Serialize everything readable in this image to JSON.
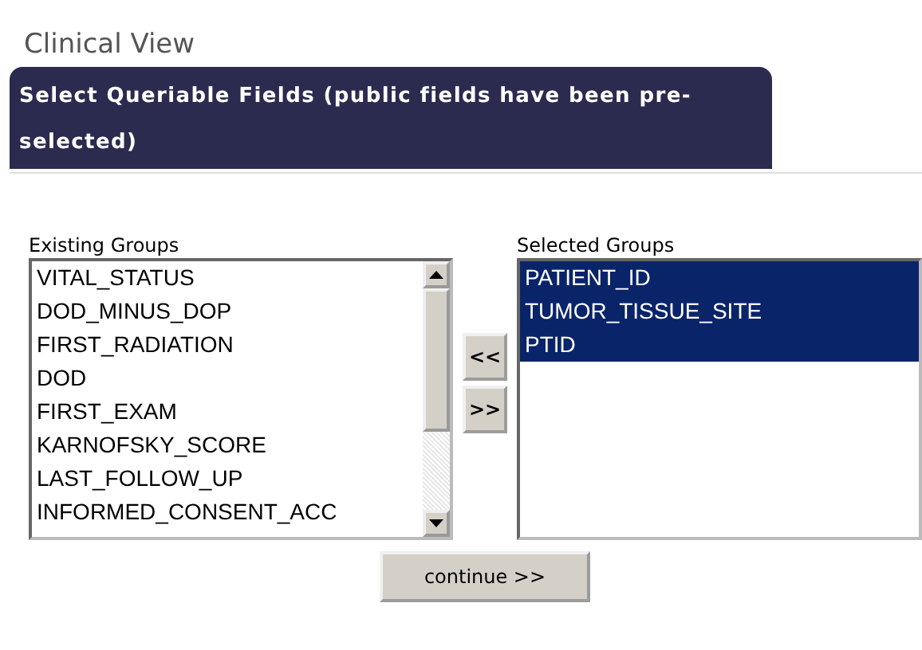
{
  "page_title": "Clinical View",
  "header": "Select Queriable Fields (public fields have been pre-selected)",
  "existing": {
    "label": "Existing Groups",
    "items": [
      {
        "text": "VITAL_STATUS",
        "selected": false
      },
      {
        "text": "DOD_MINUS_DOP",
        "selected": false
      },
      {
        "text": "FIRST_RADIATION",
        "selected": false
      },
      {
        "text": "DOD",
        "selected": false
      },
      {
        "text": "FIRST_EXAM",
        "selected": false
      },
      {
        "text": "KARNOFSKY_SCORE",
        "selected": false
      },
      {
        "text": "LAST_FOLLOW_UP",
        "selected": false
      },
      {
        "text": "INFORMED_CONSENT_ACC",
        "selected": false
      }
    ]
  },
  "move_buttons": [
    "<<",
    ">>"
  ],
  "selected_groups": {
    "label": "Selected Groups",
    "items": [
      {
        "text": "PATIENT_ID",
        "selected": true
      },
      {
        "text": "TUMOR_TISSUE_SITE",
        "selected": true
      },
      {
        "text": "PTID",
        "selected": true
      }
    ]
  },
  "continue_button": "continue >>"
}
